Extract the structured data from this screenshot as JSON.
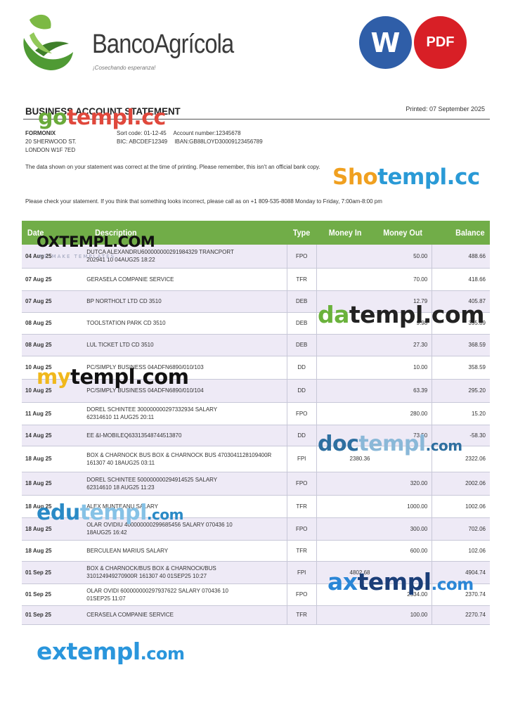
{
  "bank": {
    "name": "BancoAgrícola",
    "tagline": "¡Cosechando esperanza!"
  },
  "badges": {
    "word": "W",
    "pdf": "PDF"
  },
  "statement": {
    "title": "BUSINESS ACCOUNT STATEMENT",
    "printed": "Printed: 07 September 2025"
  },
  "customer": {
    "name": "FORMONIX",
    "address_line1": "20 SHERWOOD ST.",
    "address_line2": "LONDON W1F 7ED"
  },
  "account": {
    "sort_code": "Sort code: 01-12-45",
    "account_number": "Account number:12345678",
    "bic": "BIC: ABCDEF12349",
    "iban": "IBAN:GB88LOYD30009123456789"
  },
  "notes": {
    "accuracy": "The data shown on your statement was correct at the time of printing. Please remember, this isn't an official bank copy.",
    "check": "Please check your statement. If you think that something looks incorrect, please call as on +1 809-535-8088 Monday to Friday, 7:00am-8:00 pm"
  },
  "table": {
    "headers": {
      "date": "Date",
      "description": "Description",
      "type": "Type",
      "money_in": "Money In",
      "money_out": "Money Out",
      "balance": "Balance"
    },
    "rows": [
      {
        "date": "04 Aug 25",
        "desc1": "DUTCA ALEXANDRU600000000291984329 TRANCPORT",
        "desc2": "202941 10 04AUG25 18:22",
        "type": "FPO",
        "money_in": "",
        "money_out": "50.00",
        "balance": "488.66"
      },
      {
        "date": "07 Aug 25",
        "desc1": "GERASELA COMPANIE SERVICE",
        "desc2": "",
        "type": "TFR",
        "money_in": "",
        "money_out": "70.00",
        "balance": "418.66"
      },
      {
        "date": "07 Aug 25",
        "desc1": "BP NORTHOLT LTD CD 3510",
        "desc2": "",
        "type": "DEB",
        "money_in": "",
        "money_out": "12.79",
        "balance": "405.87"
      },
      {
        "date": "08 Aug 25",
        "desc1": "TOOLSTATION PARK CD 3510",
        "desc2": "",
        "type": "DEB",
        "money_in": "",
        "money_out": "9.98",
        "balance": "395.89"
      },
      {
        "date": "08 Aug 25",
        "desc1": "LUL TICKET LTD CD 3510",
        "desc2": "",
        "type": "DEB",
        "money_in": "",
        "money_out": "27.30",
        "balance": "368.59"
      },
      {
        "date": "10 Aug 25",
        "desc1": "PC/SIMPLY BUSINESS 04ADFN6890/010/103",
        "desc2": "",
        "type": "DD",
        "money_in": "",
        "money_out": "10.00",
        "balance": "358.59"
      },
      {
        "date": "10 Aug 25",
        "desc1": "PC/SIMPLY BUSINESS 04ADFN6890/010/104",
        "desc2": "",
        "type": "DD",
        "money_in": "",
        "money_out": "63.39",
        "balance": "295.20"
      },
      {
        "date": "11 Aug 25",
        "desc1": "DOREL SCHINTEE 300000000297332934 SALARY",
        "desc2": "62314610 11 AUG25 20:11",
        "type": "FPO",
        "money_in": "",
        "money_out": "280.00",
        "balance": "15.20"
      },
      {
        "date": "14 Aug 25",
        "desc1": "EE &I-MOBILEQ63313548744513870",
        "desc2": "",
        "type": "DD",
        "money_in": "",
        "money_out": "73.50",
        "balance": "-58.30"
      },
      {
        "date": "18 Aug 25",
        "desc1": "BOX & CHARNOCK BUS BOX & CHARNOCK BUS 4703041128109400R",
        "desc2": "161307 40 18AUG25 03:11",
        "type": "FPI",
        "money_in": "2380.36",
        "money_out": "",
        "balance": "2322.06"
      },
      {
        "date": "18 Aug 25",
        "desc1": "DOREL SCHINTEE 500000000294914525 SALARY",
        "desc2": "62314610 18 AUG25 11:23",
        "type": "FPO",
        "money_in": "",
        "money_out": "320.00",
        "balance": "2002.06"
      },
      {
        "date": "18 Aug 25",
        "desc1": "ALEX MUNTEANU SALARY",
        "desc2": "",
        "type": "TFR",
        "money_in": "",
        "money_out": "1000.00",
        "balance": "1002.06"
      },
      {
        "date": "18 Aug 25",
        "desc1": "OLAR OVIDIU 400000000299685456 SALARY 070436 10",
        "desc2": "18AUG25 16:42",
        "type": "FPO",
        "money_in": "",
        "money_out": "300.00",
        "balance": "702.06"
      },
      {
        "date": "18 Aug 25",
        "desc1": "BERCULEAN MARIUS SALARY",
        "desc2": "",
        "type": "TFR",
        "money_in": "",
        "money_out": "600.00",
        "balance": "102.06"
      },
      {
        "date": "01 Sep 25",
        "desc1": "BOX & CHARNOCK/BUS BOX & CHARNOCK/BUS",
        "desc2": "310124949270900R 161307 40 01SEP25 10:27",
        "type": "FPI",
        "money_in": "4802.68",
        "money_out": "",
        "balance": "4904.74"
      },
      {
        "date": "01 Sep 25",
        "desc1": "OLAR OVIDI 600000000297937622 SALARY 070436 10",
        "desc2": "01SEP25 11:07",
        "type": "FPO",
        "money_in": "",
        "money_out": "2534.00",
        "balance": "2370.74"
      },
      {
        "date": "01 Sep 25",
        "desc1": "CERASELA COMPANIE SERVICE",
        "desc2": "",
        "type": "TFR",
        "money_in": "",
        "money_out": "100.00",
        "balance": "2270.74"
      }
    ]
  },
  "watermarks": {
    "gotempl": [
      "go",
      "templ.cc"
    ],
    "shotempl": [
      "Sho",
      "templ.cc"
    ],
    "oxtempl": "OXTEMPL.COM",
    "oxtempl_sub": "WE MAKE TEMPLATES",
    "datempl": [
      "da",
      "templ.com"
    ],
    "mytempl": [
      "my",
      "templ.com"
    ],
    "doctempl": [
      "doc",
      "templ",
      ".com"
    ],
    "edutempl": [
      "edu",
      "templ",
      ".com"
    ],
    "axtempl": [
      "ax",
      "templ",
      ".com"
    ],
    "extempl": [
      "ex",
      "templ",
      ".com"
    ]
  },
  "colors": {
    "header_green": "#71ad48",
    "row_alt": "#eeeaf6",
    "badge_word": "#2f5ea8",
    "badge_pdf": "#d81f26"
  }
}
